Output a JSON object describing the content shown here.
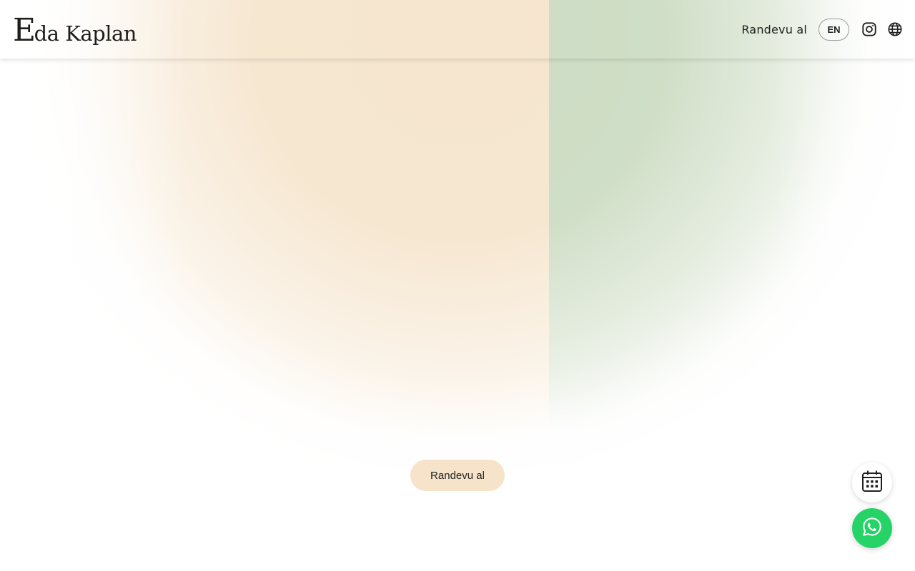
{
  "brand": {
    "logo_initial": "E",
    "logo_rest": "da Kaplan"
  },
  "header": {
    "nav_link_label": "Randevu al",
    "language_label": "EN",
    "icons": [
      "instagram-icon",
      "globe-icon"
    ]
  },
  "hero": {
    "cta_label": "Randevu al",
    "colors": {
      "warm_panel": "#f6e6cf",
      "green_panel": "#cddcc3",
      "cta_background": "#f6e3c9"
    }
  },
  "floating_actions": {
    "icons": [
      "calendar-icon",
      "whatsapp-icon"
    ],
    "colors": {
      "calendar_background": "#ffffff",
      "whatsapp_background": "#25d366"
    }
  }
}
